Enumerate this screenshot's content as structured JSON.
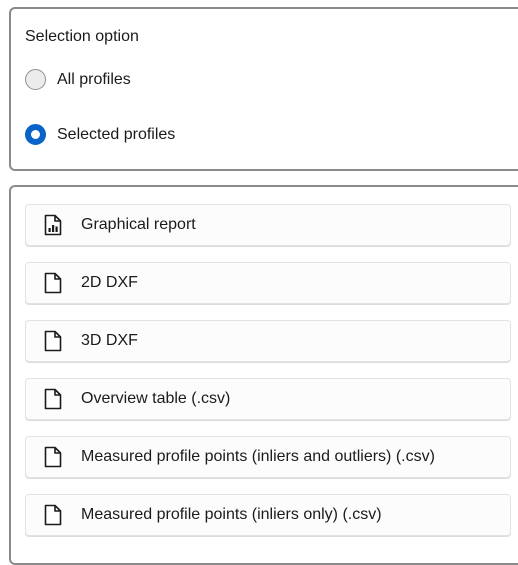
{
  "selection": {
    "title": "Selection option",
    "options": [
      {
        "label": "All profiles",
        "selected": false
      },
      {
        "label": "Selected profiles",
        "selected": true
      }
    ]
  },
  "exports": {
    "items": [
      {
        "label": "Graphical report",
        "icon": "report-chart-icon"
      },
      {
        "label": "2D DXF",
        "icon": "document-icon"
      },
      {
        "label": "3D DXF",
        "icon": "document-icon"
      },
      {
        "label": "Overview table (.csv)",
        "icon": "document-icon"
      },
      {
        "label": "Measured profile points (inliers and outliers) (.csv)",
        "icon": "document-icon"
      },
      {
        "label": "Measured profile points (inliers only) (.csv)",
        "icon": "document-icon"
      }
    ]
  },
  "colors": {
    "accent": "#0a63c6",
    "panel_border": "#8a8a8a"
  }
}
